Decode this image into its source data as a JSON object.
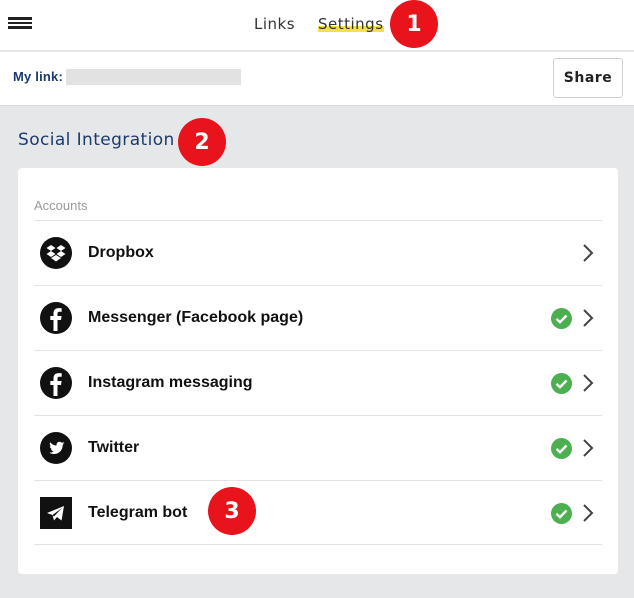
{
  "header": {
    "tabs": [
      {
        "label": "Links"
      },
      {
        "label": "Settings",
        "active": true
      }
    ]
  },
  "link_bar": {
    "label": "My link:",
    "share_label": "Share"
  },
  "section": {
    "title": "Social Integration"
  },
  "accounts": {
    "label": "Accounts",
    "items": [
      {
        "name": "Dropbox",
        "icon": "dropbox-icon",
        "connected": false
      },
      {
        "name": "Messenger (Facebook page)",
        "icon": "facebook-icon",
        "connected": true
      },
      {
        "name": "Instagram messaging",
        "icon": "facebook-icon",
        "connected": true
      },
      {
        "name": "Twitter",
        "icon": "twitter-icon",
        "connected": true
      },
      {
        "name": "Telegram bot",
        "icon": "telegram-icon",
        "connected": true
      }
    ]
  },
  "annotations": [
    "1",
    "2",
    "3"
  ],
  "colors": {
    "accent_navy": "#1c3a6e",
    "highlight_yellow": "#f4e047",
    "badge_red": "#e8131b",
    "check_green": "#4caf50"
  }
}
